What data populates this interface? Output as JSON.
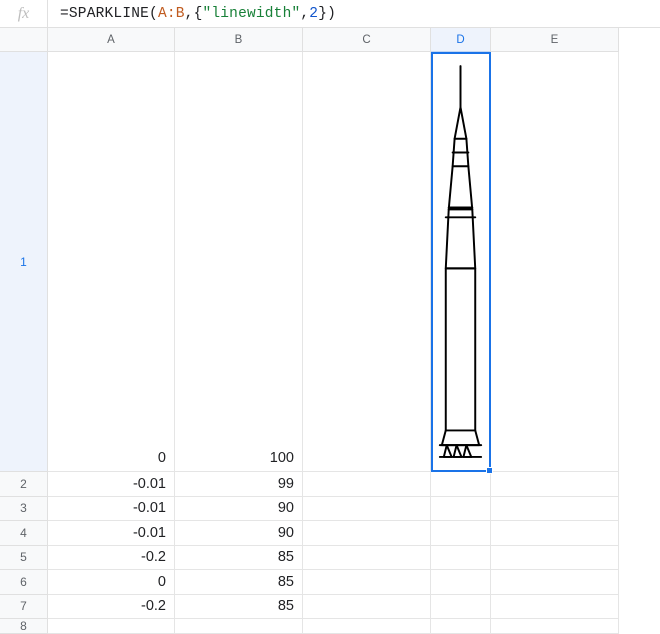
{
  "formula": {
    "prefix": "=",
    "func": "SPARKLINE",
    "range": "A:B",
    "option_key": "\"linewidth\"",
    "option_val": "2",
    "raw": "=SPARKLINE(A:B,{\"linewidth\",2})"
  },
  "fx_label": "fx",
  "columns": [
    "A",
    "B",
    "C",
    "D",
    "E"
  ],
  "selected_cell": "D1",
  "selected_column": "D",
  "selected_row": 1,
  "rows": [
    {
      "num": 1,
      "A": "0",
      "B": "100",
      "height": "r1"
    },
    {
      "num": 2,
      "A": "-0.01",
      "B": "99",
      "height": "rN"
    },
    {
      "num": 3,
      "A": "-0.01",
      "B": "90",
      "height": "rN"
    },
    {
      "num": 4,
      "A": "-0.01",
      "B": "90",
      "height": "rN"
    },
    {
      "num": 5,
      "A": "-0.2",
      "B": "85",
      "height": "rN"
    },
    {
      "num": 6,
      "A": "0",
      "B": "85",
      "height": "rN"
    },
    {
      "num": 7,
      "A": "-0.2",
      "B": "85",
      "height": "rN"
    },
    {
      "num": 8,
      "A": "",
      "B": "",
      "height": "r8"
    }
  ],
  "chart_data": {
    "type": "line",
    "title": "",
    "note": "Sparkline drawn from columns A (x-offset pairs) and B (y). Points form a rocket silhouette.",
    "series": [
      {
        "name": "A",
        "values": [
          0,
          -0.01,
          -0.01,
          -0.01,
          -0.2,
          0,
          -0.2
        ]
      },
      {
        "name": "B",
        "values": [
          100,
          99,
          90,
          90,
          85,
          85,
          85
        ]
      }
    ],
    "options": {
      "linewidth": 2
    }
  }
}
